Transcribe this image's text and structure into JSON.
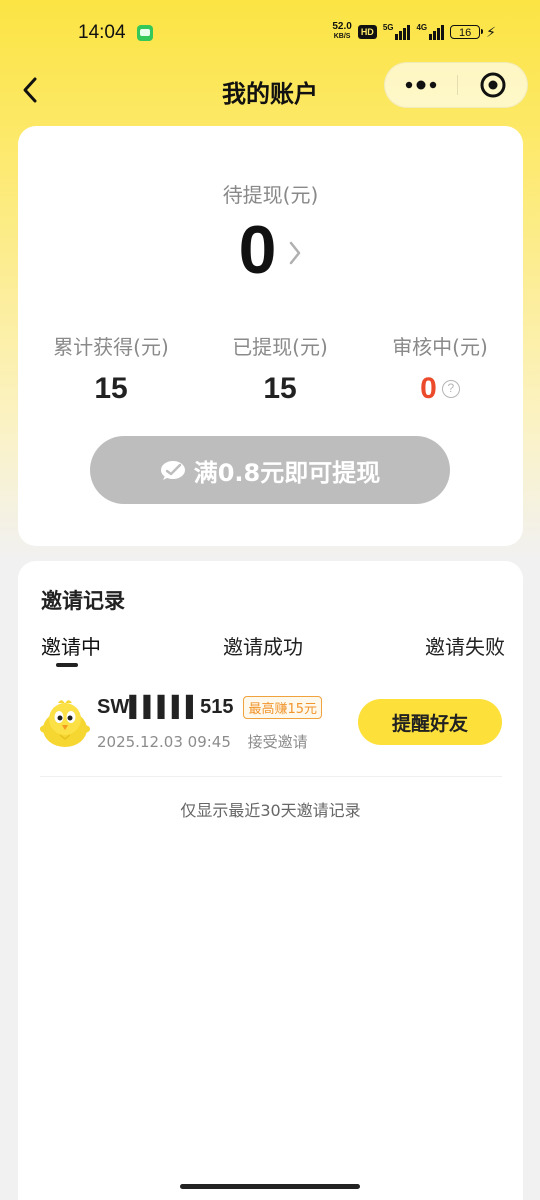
{
  "status_bar": {
    "time": "14:04",
    "net_speed_value": "52.0",
    "net_speed_unit": "KB/S",
    "hd_label": "HD",
    "signal1_tag": "5G",
    "signal2_tag": "4G",
    "battery_level": "16"
  },
  "nav": {
    "title": "我的账户"
  },
  "account": {
    "pending_label": "待提现(元)",
    "pending_value": "0",
    "stats": [
      {
        "label": "累计获得(元)",
        "value": "15"
      },
      {
        "label": "已提现(元)",
        "value": "15"
      },
      {
        "label": "审核中(元)",
        "value": "0"
      }
    ],
    "help_symbol": "?",
    "withdraw_button_label": "满0.8元即可提现"
  },
  "invite": {
    "title": "邀请记录",
    "tabs": [
      {
        "label": "邀请中",
        "active": true
      },
      {
        "label": "邀请成功",
        "active": false
      },
      {
        "label": "邀请失败",
        "active": false
      }
    ],
    "items": [
      {
        "name": "SW▌▌▌▌▌515",
        "badge": "最高赚15元",
        "date": "2025.12.03 09:45",
        "status": "接受邀请",
        "action_label": "提醒好友"
      }
    ],
    "footnote": "仅显示最近30天邀请记录"
  },
  "colors": {
    "brand_yellow": "#fde03a",
    "accent_red": "#ec4b2b",
    "badge_orange": "#f0952c",
    "disabled_gray": "#bdbdbd"
  },
  "icons": {
    "back": "back-arrow-icon",
    "more": "more-dots-icon",
    "close": "mini-program-close-icon",
    "chevron": "chevron-right-icon",
    "help": "question-circle-icon",
    "wechat": "wechat-pay-icon"
  }
}
